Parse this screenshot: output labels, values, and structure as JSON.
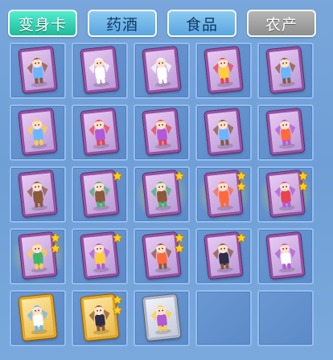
{
  "tabs": [
    {
      "label": "变身卡",
      "state": "active"
    },
    {
      "label": "药酒",
      "state": "inactive"
    },
    {
      "label": "食品",
      "state": "inactive"
    },
    {
      "label": "农产",
      "state": "gray"
    }
  ],
  "colors": {
    "tab_active": "#20b99a",
    "tab_inactive": "#5aa6e0",
    "tab_gray": "#8e8e8e",
    "card_purple": "#9a4fa2",
    "card_gold": "#e7a51c",
    "star": "#ffd21a",
    "panel": "#6f9fd6"
  },
  "inventory": {
    "rows": [
      [
        {
          "item": "red-robot-card",
          "frame": "purple",
          "stars": 0
        },
        {
          "item": "white-fairy-card",
          "frame": "purple",
          "stars": 0
        },
        {
          "item": "white-fairy-card",
          "frame": "purple",
          "stars": 0
        },
        {
          "item": "brown-warrior-card",
          "frame": "purple",
          "stars": 0
        },
        {
          "item": "green-monk-card",
          "frame": "purple",
          "stars": 0
        }
      ],
      [
        {
          "item": "red-bird-card",
          "frame": "purple",
          "stars": 0
        },
        {
          "item": "red-hero-card",
          "frame": "purple",
          "stars": 0
        },
        {
          "item": "red-hero-card",
          "frame": "purple",
          "stars": 0
        },
        {
          "item": "winged-girl-card",
          "frame": "purple",
          "stars": 0
        },
        {
          "item": "blue-bear-card",
          "frame": "purple",
          "stars": 0
        }
      ],
      [
        {
          "item": "purple-dancer-card",
          "frame": "purple",
          "stars": 0
        },
        {
          "item": "armored-brute-card",
          "frame": "purple",
          "stars": 1
        },
        {
          "item": "water-spirit-card",
          "frame": "purple",
          "stars": 1,
          "glow": true
        },
        {
          "item": "blue-fairy-card",
          "frame": "purple",
          "stars": 2,
          "glow": true
        },
        {
          "item": "fire-phoenix-card",
          "frame": "purple",
          "stars": 2,
          "glow": true
        }
      ],
      [
        {
          "item": "red-girl-card",
          "frame": "purple",
          "stars": 2,
          "glow": true
        },
        {
          "item": "pink-beast-card",
          "frame": "purple",
          "stars": 1
        },
        {
          "item": "dark-winged-card",
          "frame": "purple",
          "stars": 2
        },
        {
          "item": "panda-warrior-card",
          "frame": "purple",
          "stars": 1
        },
        {
          "item": "shadow-ninja-card",
          "frame": "purple",
          "stars": 0
        }
      ],
      [
        {
          "item": "golden-fairy-card",
          "frame": "gold",
          "stars": 0
        },
        {
          "item": "golden-princess-card",
          "frame": "gold",
          "stars": 2
        },
        {
          "item": "purple-knight-card",
          "frame": "silver",
          "stars": 0
        },
        {
          "item": "empty-slot",
          "frame": "none",
          "stars": 0
        },
        {
          "item": "empty-slot",
          "frame": "none",
          "stars": 0
        }
      ]
    ]
  }
}
